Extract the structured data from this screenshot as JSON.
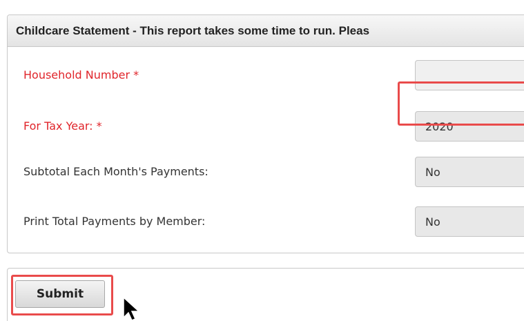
{
  "panel": {
    "title": "Childcare Statement - This report takes some time to run. Pleas"
  },
  "form": {
    "fields": [
      {
        "label": "Household Number *",
        "value": ""
      },
      {
        "label": "For Tax Year: *",
        "value": "2020"
      },
      {
        "label": "Subtotal Each Month's Payments:",
        "value": "No"
      },
      {
        "label": "Print Total Payments by Member:",
        "value": "No"
      }
    ]
  },
  "actions": {
    "submit_label": "Submit"
  },
  "colors": {
    "required_label": "#e0242a",
    "highlight": "#e94b4b",
    "field_background": "#e8e8e8"
  },
  "icons": {
    "cursor": "mouse-pointer-icon"
  }
}
